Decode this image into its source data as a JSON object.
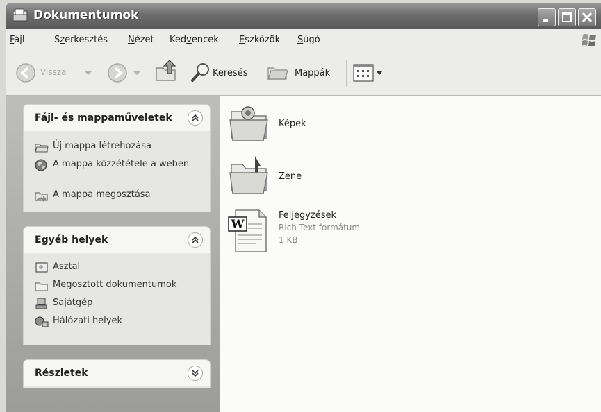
{
  "window": {
    "title": "Dokumentumok",
    "icons": {
      "app": "folder-documents-icon",
      "minimize": "minimize-icon",
      "maximize": "maximize-icon",
      "close": "close-icon"
    }
  },
  "menu": {
    "items": [
      {
        "name": "file",
        "label": "Fájl",
        "accel": "F",
        "rest": "ájl"
      },
      {
        "name": "edit",
        "label": "Szerkesztés",
        "accel": "z",
        "pre": "S",
        "rest": "erkesztés"
      },
      {
        "name": "view",
        "label": "Nézet",
        "accel": "N",
        "rest": "ézet"
      },
      {
        "name": "favorites",
        "label": "Kedvencek",
        "pre": "Ked",
        "accel": "v",
        "rest": "encek"
      },
      {
        "name": "tools",
        "label": "Eszközök",
        "accel": "E",
        "rest": "szközök"
      },
      {
        "name": "help",
        "label": "Súgó",
        "accel": "S",
        "rest": "úgó"
      }
    ]
  },
  "toolbar": {
    "back_label": "Vissza",
    "search_label": "Keresés",
    "folders_label": "Mappák"
  },
  "panels": {
    "file_tasks": {
      "title": "Fájl- és mappaműveletek",
      "items": [
        {
          "label": "Új mappa létrehozása",
          "icon": "new-folder-icon"
        },
        {
          "label": "A mappa közzététele a weben",
          "icon": "globe-icon"
        },
        {
          "label": "A mappa megosztása",
          "icon": "share-folder-icon"
        }
      ]
    },
    "other_places": {
      "title": "Egyéb helyek",
      "items": [
        {
          "label": "Asztal",
          "icon": "desktop-icon"
        },
        {
          "label": "Megosztott dokumentumok",
          "icon": "shared-folder-icon"
        },
        {
          "label": "Sajátgép",
          "icon": "computer-icon"
        },
        {
          "label": "Hálózati helyek",
          "icon": "network-icon"
        }
      ]
    },
    "details": {
      "title": "Részletek"
    }
  },
  "files": [
    {
      "name": "Képek",
      "icon": "pictures-folder-icon"
    },
    {
      "name": "Zene",
      "icon": "music-folder-icon"
    },
    {
      "name": "Feljegyzések",
      "type": "Rich Text formátum",
      "size": "1 KB",
      "icon": "word-document-icon"
    }
  ]
}
